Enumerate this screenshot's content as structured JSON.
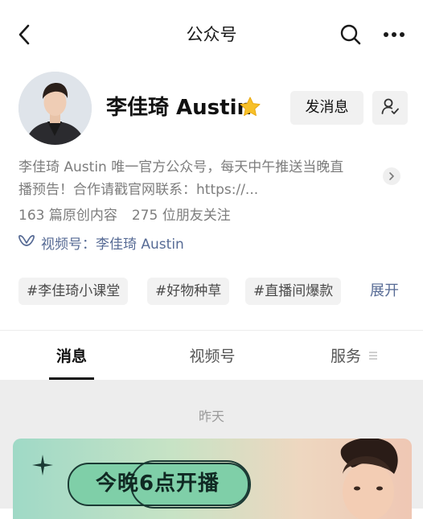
{
  "nav": {
    "title": "公众号",
    "icons": [
      "back-icon",
      "search-icon",
      "more-icon"
    ]
  },
  "profile": {
    "name": "李佳琦 Austin",
    "verified_icon": "star-icon",
    "message_button": "发消息",
    "follow_icon": "user-check-icon",
    "description_line1": "李佳琦 Austin 唯一官方公众号，每天中午推送当晚直",
    "description_line2": "播预告！合作请戳官网联系：https://...",
    "original_count": "163 篇原创内容",
    "followers": "275 位朋友关注",
    "channel": "视频号：李佳琦 Austin"
  },
  "tags": {
    "items": [
      "#李佳琦小课堂",
      "#好物种草",
      "#直播间爆款"
    ],
    "expand": "展开"
  },
  "tabs": {
    "items": [
      "消息",
      "视频号",
      "服务"
    ],
    "active": "消息"
  },
  "feed": {
    "date": "昨天",
    "card_headline": "今晚6点开播"
  },
  "colors": {
    "link": "#576b95",
    "secondary_text": "#7d7d7d",
    "verified": "#f7c028",
    "feed_bg": "#ededed"
  }
}
